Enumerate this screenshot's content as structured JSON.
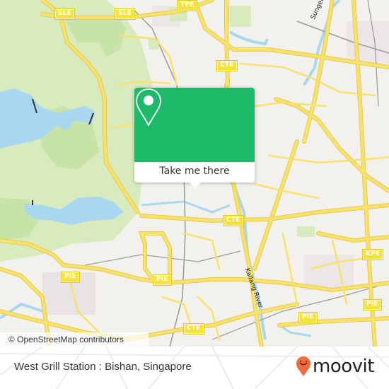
{
  "map": {
    "attribution": "© OpenStreetMap contributors",
    "colors": {
      "land": "#f2f1ee",
      "park": "#d8ebbf",
      "forest": "#c7e3a6",
      "water": "#a8d8ef",
      "road": "#f7e26b",
      "road_casing": "#e9c94a",
      "rail": "#999999"
    },
    "shields": [
      {
        "id": "sle-1",
        "label": "SLE"
      },
      {
        "id": "sle-2",
        "label": "SLE"
      },
      {
        "id": "tpe",
        "label": "TPE"
      },
      {
        "id": "cte-1",
        "label": "CTE"
      },
      {
        "id": "cte-2",
        "label": "CTE"
      },
      {
        "id": "cte-3",
        "label": "CTE"
      },
      {
        "id": "pie-1",
        "label": "PIE"
      },
      {
        "id": "pie-2",
        "label": "PIE"
      },
      {
        "id": "pie-3",
        "label": "PIE"
      },
      {
        "id": "pie-4",
        "label": "PIE"
      },
      {
        "id": "kpe",
        "label": "KPE"
      }
    ],
    "river_labels": [
      {
        "id": "sungei-punggol",
        "label": "Sungei Punggol"
      },
      {
        "id": "kallang-river",
        "label": "Kallang River"
      }
    ]
  },
  "popup": {
    "icon": "map-pin-icon",
    "button_label": "Take me there",
    "accent": "#1dba6a"
  },
  "footer": {
    "place_name": "West Grill Station : Bishan, Singapore",
    "brand": "moovit",
    "brand_color": "#f26a3d"
  }
}
